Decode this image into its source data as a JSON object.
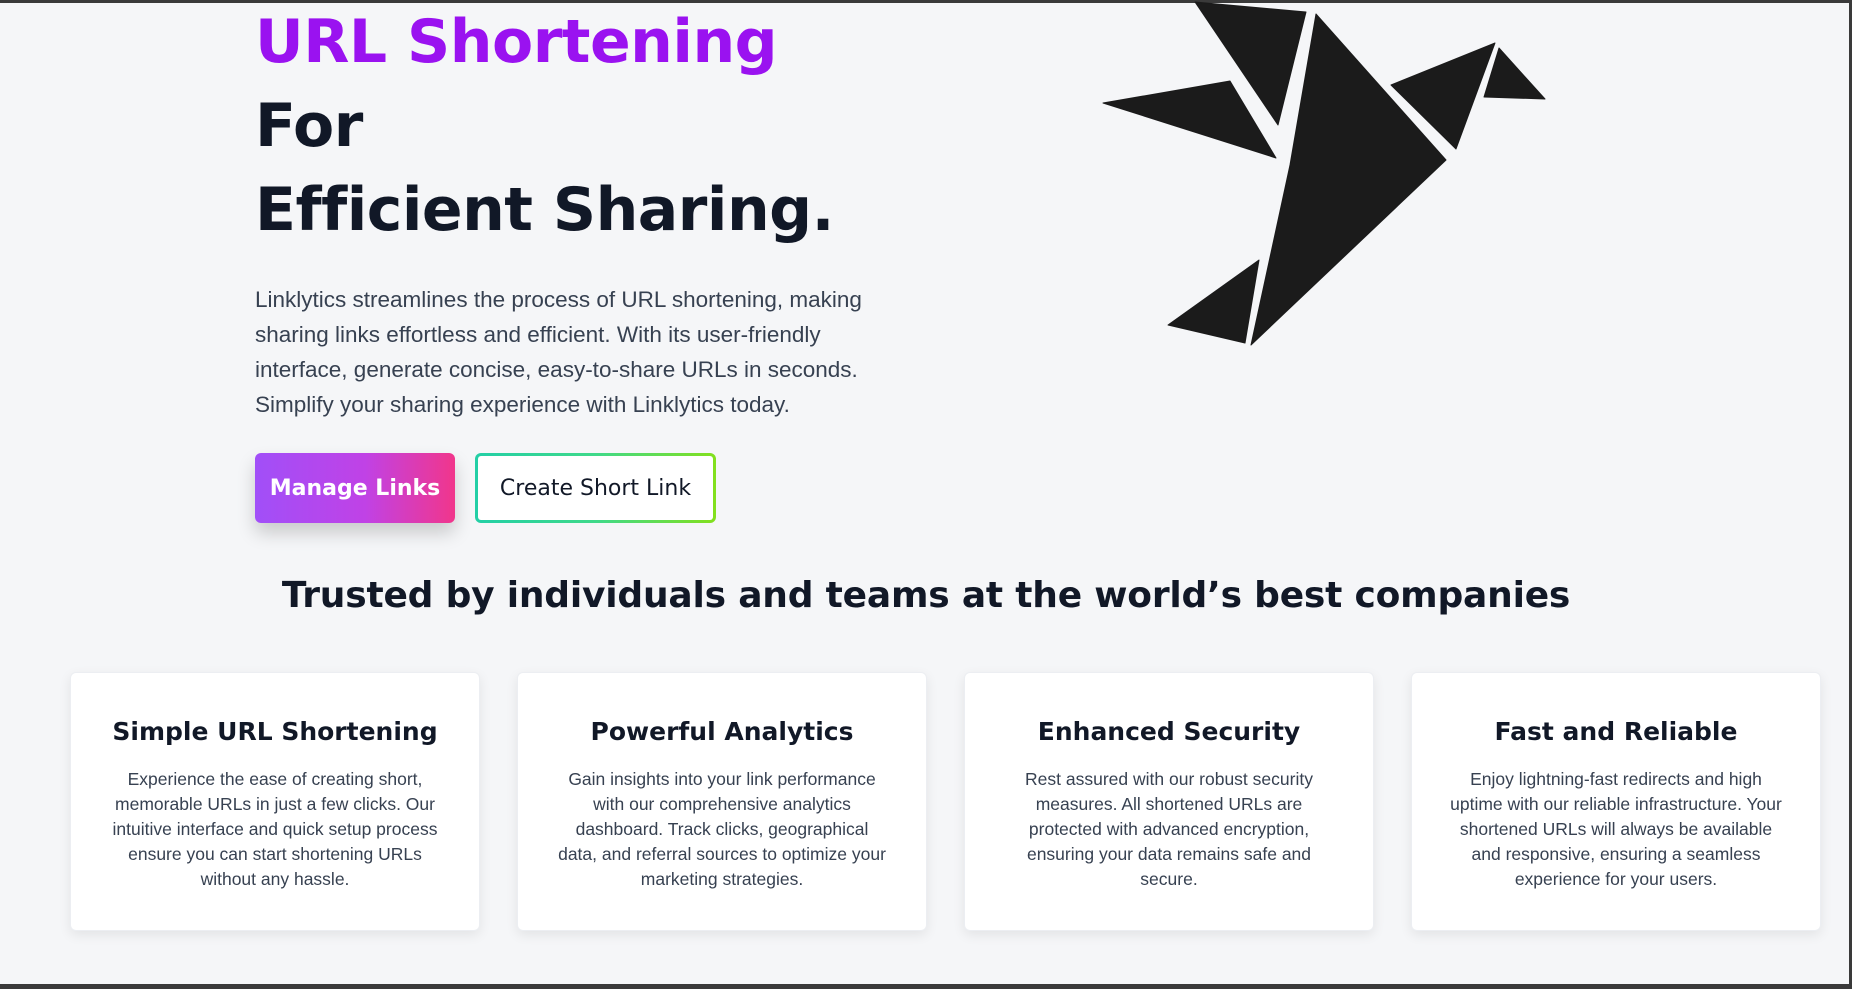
{
  "hero": {
    "title_accent": "URL Shortening",
    "title_rest_line1": " For",
    "title_line2": "Efficient Sharing.",
    "description": "Linklytics streamlines the process of URL shortening, making sharing links effortless and efficient. With its user-friendly interface, generate concise, easy-to-share URLs in seconds. Simplify your sharing experience with Linklytics today.",
    "primary_button": "Manage Links",
    "secondary_button": "Create Short Link"
  },
  "illustration": {
    "icon": "origami-bird-icon"
  },
  "trusted": {
    "heading": "Trusted by individuals and teams at the world’s best companies"
  },
  "features": [
    {
      "title": "Simple URL Shortening",
      "text": "Experience the ease of creating short, memorable URLs in just a few clicks. Our intuitive interface and quick setup process ensure you can start shortening URLs without any hassle."
    },
    {
      "title": "Powerful Analytics",
      "text": "Gain insights into your link performance with our comprehensive analytics dashboard. Track clicks, geographical data, and referral sources to optimize your marketing strategies."
    },
    {
      "title": "Enhanced Security",
      "text": "Rest assured with our robust security measures. All shortened URLs are protected with advanced encryption, ensuring your data remains safe and secure."
    },
    {
      "title": "Fast and Reliable",
      "text": "Enjoy lightning-fast redirects and high uptime with our reliable infrastructure. Your shortened URLs will always be available and responsive, ensuring a seamless experience for your users."
    }
  ],
  "colors": {
    "accent": "#9a12f0",
    "primary_gradient_start": "#a14ff8",
    "primary_gradient_end": "#f1368b",
    "outline_gradient_start": "#23cfa6",
    "outline_gradient_end": "#83e01d",
    "heading": "#111827",
    "background": "#f5f6f8"
  }
}
